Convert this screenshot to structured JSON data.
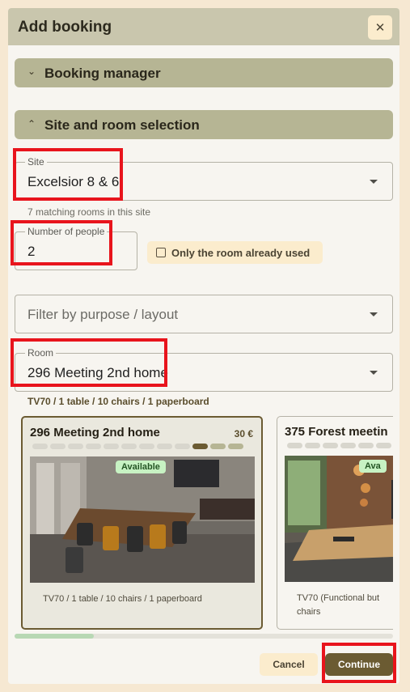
{
  "dialog": {
    "title": "Add booking",
    "close_icon": "close-icon"
  },
  "accordions": [
    {
      "label": "Booking manager",
      "icon": "chevron-down-icon"
    },
    {
      "label": "Site and room selection",
      "icon": "chevron-up-icon"
    }
  ],
  "site": {
    "legend": "Site",
    "value": "Excelsior 8 & 6",
    "hint": "7 matching rooms in this site"
  },
  "people": {
    "legend": "Number of people",
    "value": "2"
  },
  "only_room_toggle": {
    "label": "Only the room already used",
    "checked": false
  },
  "purpose": {
    "placeholder": "Filter by purpose / layout"
  },
  "room": {
    "legend": "Room",
    "value": "296 Meeting 2nd home",
    "description": "TV70 / 1 table / 10 chairs / 1 paperboard"
  },
  "cards": [
    {
      "name": "296 Meeting 2nd home",
      "price": "30 €",
      "availability": "Available",
      "description": "TV70 / 1 table / 10 chairs / 1 paperboard",
      "selected": true,
      "occupancy_level": 0.83
    },
    {
      "name": "375 Forest meetin",
      "availability": "Ava",
      "description_line1": "TV70 (Functional but",
      "description_line2": "chairs",
      "selected": false
    }
  ],
  "scroll": {
    "position": 0.21
  },
  "footer": {
    "cancel": "Cancel",
    "continue": "Continue"
  },
  "colors": {
    "header_bg": "#c9c6ad",
    "accordion_bg": "#b6b594",
    "accent": "#6b5b32",
    "cream": "#fbeccd",
    "available_green": "#c7f2c3",
    "highlight_red": "#e8141c"
  }
}
